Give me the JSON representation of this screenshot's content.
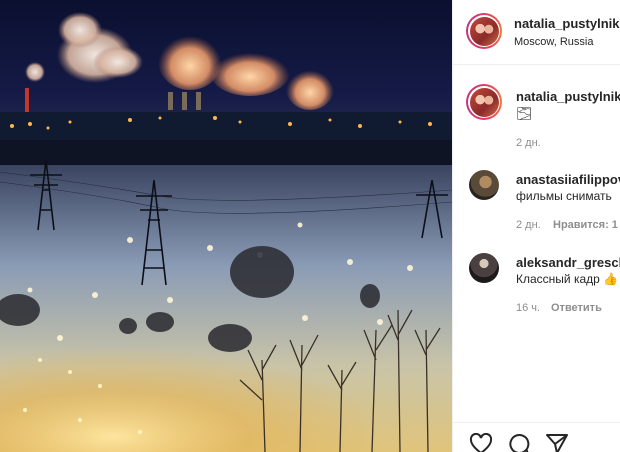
{
  "post": {
    "author": "natalia_pustylnik",
    "location": "Moscow, Russia"
  },
  "caption": {
    "author": "natalia_pustylnik",
    "text": "🌫",
    "time": "2 дн."
  },
  "comments": [
    {
      "author": "anastasiiafilippov",
      "text": "фильмы снимать",
      "time": "2 дн.",
      "likes_label": "Нравится: 1"
    },
    {
      "author": "aleksandr_greschn",
      "text": "Классный кадр 👍",
      "time": "16 ч.",
      "reply_label": "Ответить"
    }
  ],
  "icons": [
    "like-icon",
    "comment-icon",
    "share-icon"
  ]
}
